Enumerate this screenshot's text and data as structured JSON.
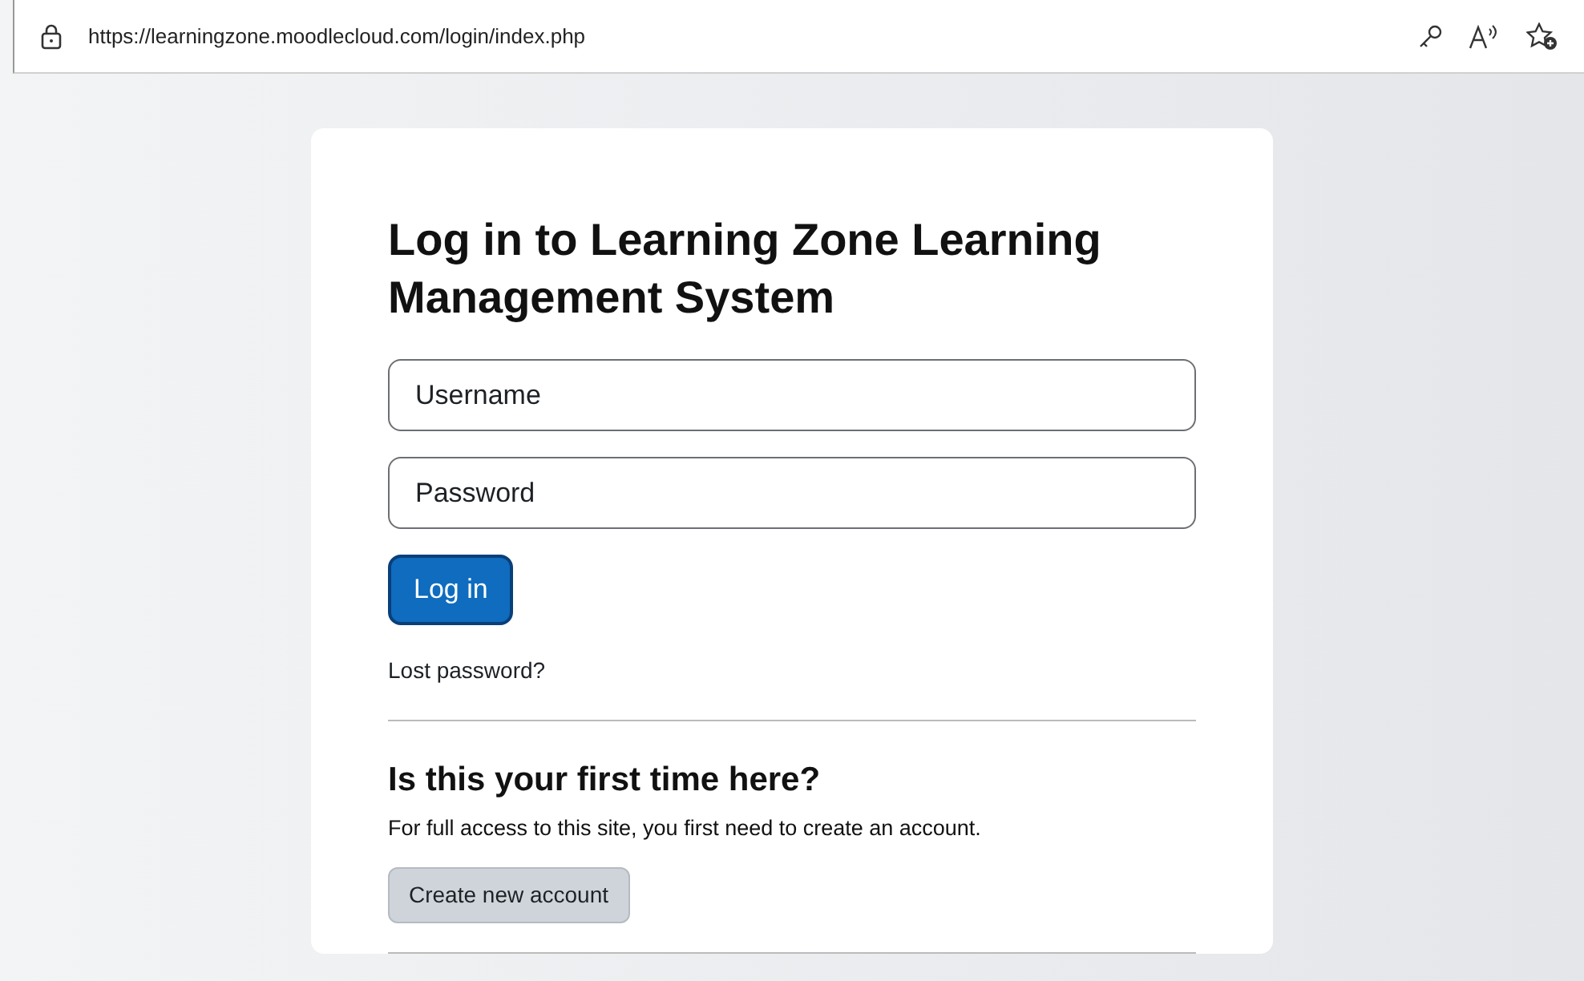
{
  "browser": {
    "url": "https://learningzone.moodlecloud.com/login/index.php"
  },
  "login": {
    "title": "Log in to Learning Zone Learning Management System",
    "fields": [
      {
        "placeholder": "Username"
      },
      {
        "placeholder": "Password"
      }
    ],
    "submit": "Log in",
    "lost_password": "Lost password?"
  },
  "signup": {
    "heading": "Is this your first time here?",
    "text": "For full access to this site, you first need to create an account.",
    "button": "Create new account"
  }
}
